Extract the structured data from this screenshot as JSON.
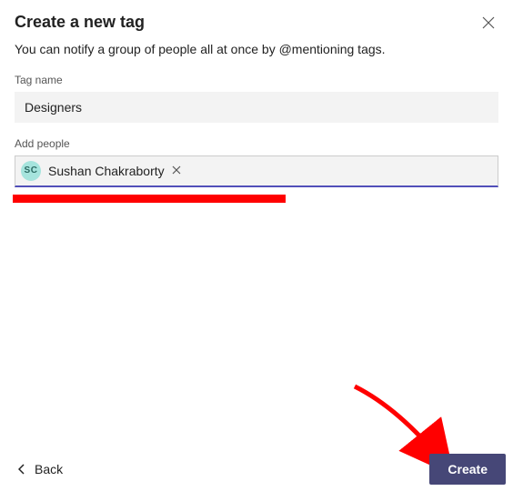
{
  "dialog": {
    "title": "Create a new tag",
    "subtitle": "You can notify a group of people all at once by @mentioning tags."
  },
  "tagName": {
    "label": "Tag name",
    "value": "Designers"
  },
  "addPeople": {
    "label": "Add people",
    "chips": [
      {
        "initials": "SC",
        "name": "Sushan Chakraborty"
      }
    ]
  },
  "footer": {
    "backLabel": "Back",
    "createLabel": "Create"
  }
}
